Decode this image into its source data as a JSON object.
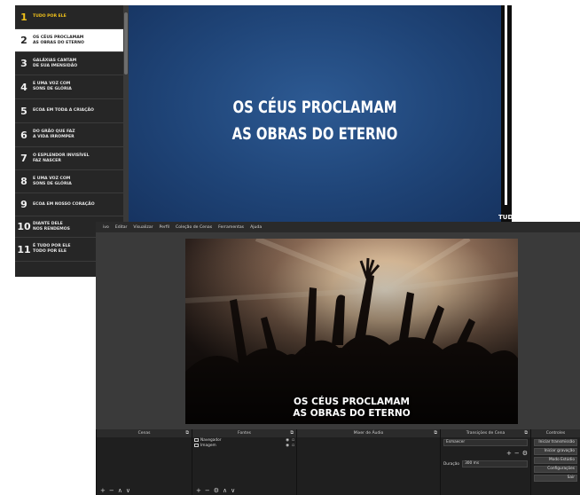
{
  "lyrics_app": {
    "verses": [
      {
        "num": "1",
        "text": "TUDO POR ELE"
      },
      {
        "num": "2",
        "text": "OS CÉUS PROCLAMAM\nAS OBRAS DO ETERNO"
      },
      {
        "num": "3",
        "text": "GALÁXIAS CANTAM\nDE SUA IMENSIDÃO"
      },
      {
        "num": "4",
        "text": "E UMA VOZ COM\nSONS DE GLÓRIA"
      },
      {
        "num": "5",
        "text": "ECOA EM TODA A CRIAÇÃO"
      },
      {
        "num": "6",
        "text": "DO GRÃO QUE FAZ\nA VIDA IRROMPER"
      },
      {
        "num": "7",
        "text": "O ESPLENDOR INVISÍVEL\nFAZ NASCER"
      },
      {
        "num": "8",
        "text": "E UMA VOZ COM\nSONS DE GLÓRIA"
      },
      {
        "num": "9",
        "text": "ECOA EM NOSSO CORAÇÃO"
      },
      {
        "num": "10",
        "text": "DIANTE DELE\nNOS RENDEMOS"
      },
      {
        "num": "11",
        "text": "É TUDO POR ELE\nTODO POR ELE"
      }
    ],
    "slide_text": "OS CÉUS PROCLAMAM\nAS OBRAS DO ETERNO",
    "logo": "TUD"
  },
  "obs": {
    "menu": [
      "ivo",
      "Editar",
      "Visualizar",
      "Perfil",
      "Coleção de Cenas",
      "Ferramentas",
      "Ajuda"
    ],
    "preview_caption": "OS CÉUS PROCLAMAM\nAS OBRAS DO ETERNO",
    "docks": {
      "scenes_title": "Cenas",
      "sources_title": "Fontes",
      "sources": [
        "Navegador",
        "Imagem"
      ],
      "mixer_title": "Mixer de Áudio",
      "transitions_title": "Transições de Cena",
      "transition_type": "Esmaecer",
      "duration_label": "Duração",
      "duration_value": "300 ms",
      "controls_title": "Controles",
      "controls": [
        "Iniciar transmissão",
        "Iniciar gravação",
        "Modo Estúdio",
        "Configurações",
        "Sair"
      ]
    }
  },
  "colors": {
    "slide_bg": "#1f4477",
    "highlight_number": "#f2c21a",
    "obs_bg": "#333333"
  }
}
